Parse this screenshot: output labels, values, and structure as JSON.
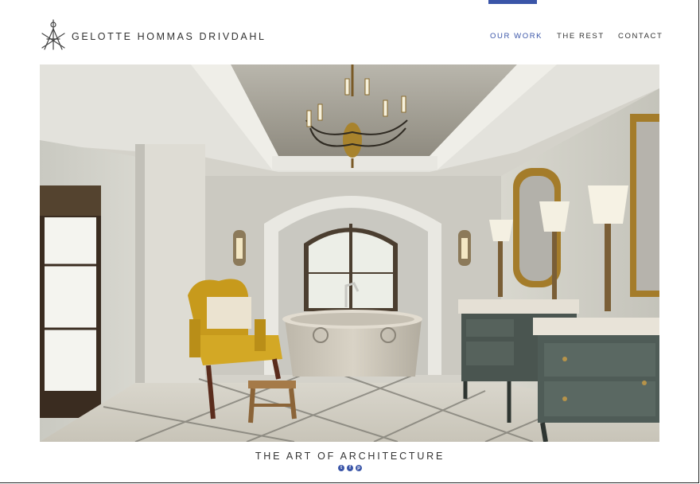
{
  "brand": {
    "name": "GELOTTE HOMMAS DRIVDAHL",
    "accent": "#3a55a8"
  },
  "nav": {
    "items": [
      {
        "label": "OUR WORK",
        "active": true
      },
      {
        "label": "THE REST",
        "active": false
      },
      {
        "label": "CONTACT",
        "active": false
      }
    ]
  },
  "hero": {
    "subject": "bathroom interior with freestanding stone tub, chandelier, yellow armchair and twin vanities"
  },
  "footer": {
    "tagline": "THE ART OF ARCHITECTURE",
    "social": [
      {
        "icon": "twitter-icon",
        "glyph": "t"
      },
      {
        "icon": "facebook-icon",
        "glyph": "f"
      },
      {
        "icon": "pinterest-icon",
        "glyph": "p"
      }
    ]
  }
}
